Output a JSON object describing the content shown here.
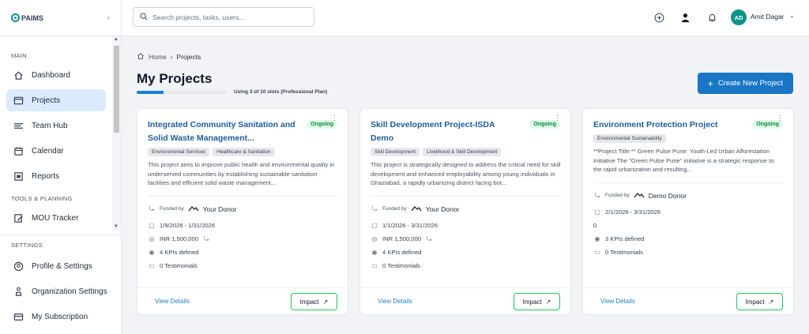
{
  "brand": {
    "logo_text": "PAIMS",
    "primary_color": "#1976c5",
    "accent_color": "#0d9488"
  },
  "sidebar": {
    "sections": [
      {
        "label": "MAIN"
      },
      {
        "label": "TOOLS & PLANNING"
      },
      {
        "label": "SETTINGS"
      }
    ],
    "main_items": [
      {
        "label": "Dashboard",
        "icon": "home-icon"
      },
      {
        "label": "Projects",
        "icon": "folder-icon",
        "active": true
      },
      {
        "label": "Team Hub",
        "icon": "team-icon"
      },
      {
        "label": "Calendar",
        "icon": "calendar-icon"
      },
      {
        "label": "Reports",
        "icon": "reports-icon"
      }
    ],
    "tools_items": [
      {
        "label": "MOU Tracker",
        "icon": "document-edit-icon"
      }
    ],
    "settings_items": [
      {
        "label": "Profile & Settings",
        "icon": "user-circle-icon"
      },
      {
        "label": "Organization Settings",
        "icon": "organization-icon"
      },
      {
        "label": "My Subscription",
        "icon": "subscription-icon"
      }
    ]
  },
  "header": {
    "search_placeholder": "Search projects, tasks, users...",
    "user": {
      "initials": "AD",
      "name": "Amit Dagar"
    }
  },
  "breadcrumb": {
    "home": "Home",
    "current": "Projects"
  },
  "page": {
    "title": "My Projects",
    "slots_text": "Using 3 of 10 slots (Professional Plan)",
    "slots_used": 3,
    "slots_total": 10,
    "create_button": "Create New Project"
  },
  "cards": [
    {
      "title": "Integrated Community Sanitation and Solid Waste Management...",
      "status": "Ongoing",
      "tags": [
        "Environmental Services",
        "Healthcare & Sanitation"
      ],
      "description": "This project aims to improve public health and environmental quality in underserved communities by establishing sustainable sanitation facilities and efficient solid waste management...",
      "funded_by_label": "Funded by",
      "donor": "Your Donor",
      "dates": "1/9/2026 - 1/31/2026",
      "budget": "INR 1,500,000",
      "kpis": "4 KPIs defined",
      "testimonials": "0 Testimonials",
      "view_link": "View Details",
      "impact_button": "Impact"
    },
    {
      "title": "Skill Development Project-ISDA Demo",
      "status": "Ongoing",
      "tags": [
        "Skill Development",
        "Livelihood & Skill Development"
      ],
      "description": "This project is strategically designed to address the critical need for skill development and enhanced employability among young individuals in Ghaziabad, a rapidly urbanizing district facing bot...",
      "funded_by_label": "Funded by",
      "donor": "Your Donor",
      "dates": "1/1/2026 - 3/31/2026",
      "budget": "INR 1,500,000",
      "kpis": "4 KPIs defined",
      "testimonials": "0 Testimonials",
      "view_link": "View Details",
      "impact_button": "Impact"
    },
    {
      "title": "Environment Protection Project",
      "status": "Ongoing",
      "tags": [
        "Environmental Sustainability"
      ],
      "description": "**Project Title:** Green Pulse Pune: Youth-Led Urban Afforestation Initiative The \"Green Pulse Pune\" initiative is a strategic response to the rapid urbanization and resulting...",
      "funded_by_label": "Funded by",
      "donor": "Demo Donor",
      "dates": "2/1/2026 - 3/31/2026",
      "budget": "0",
      "kpis": "3 KPIs defined",
      "testimonials": "0 Testimonials",
      "view_link": "View Details",
      "impact_button": "Impact"
    }
  ]
}
